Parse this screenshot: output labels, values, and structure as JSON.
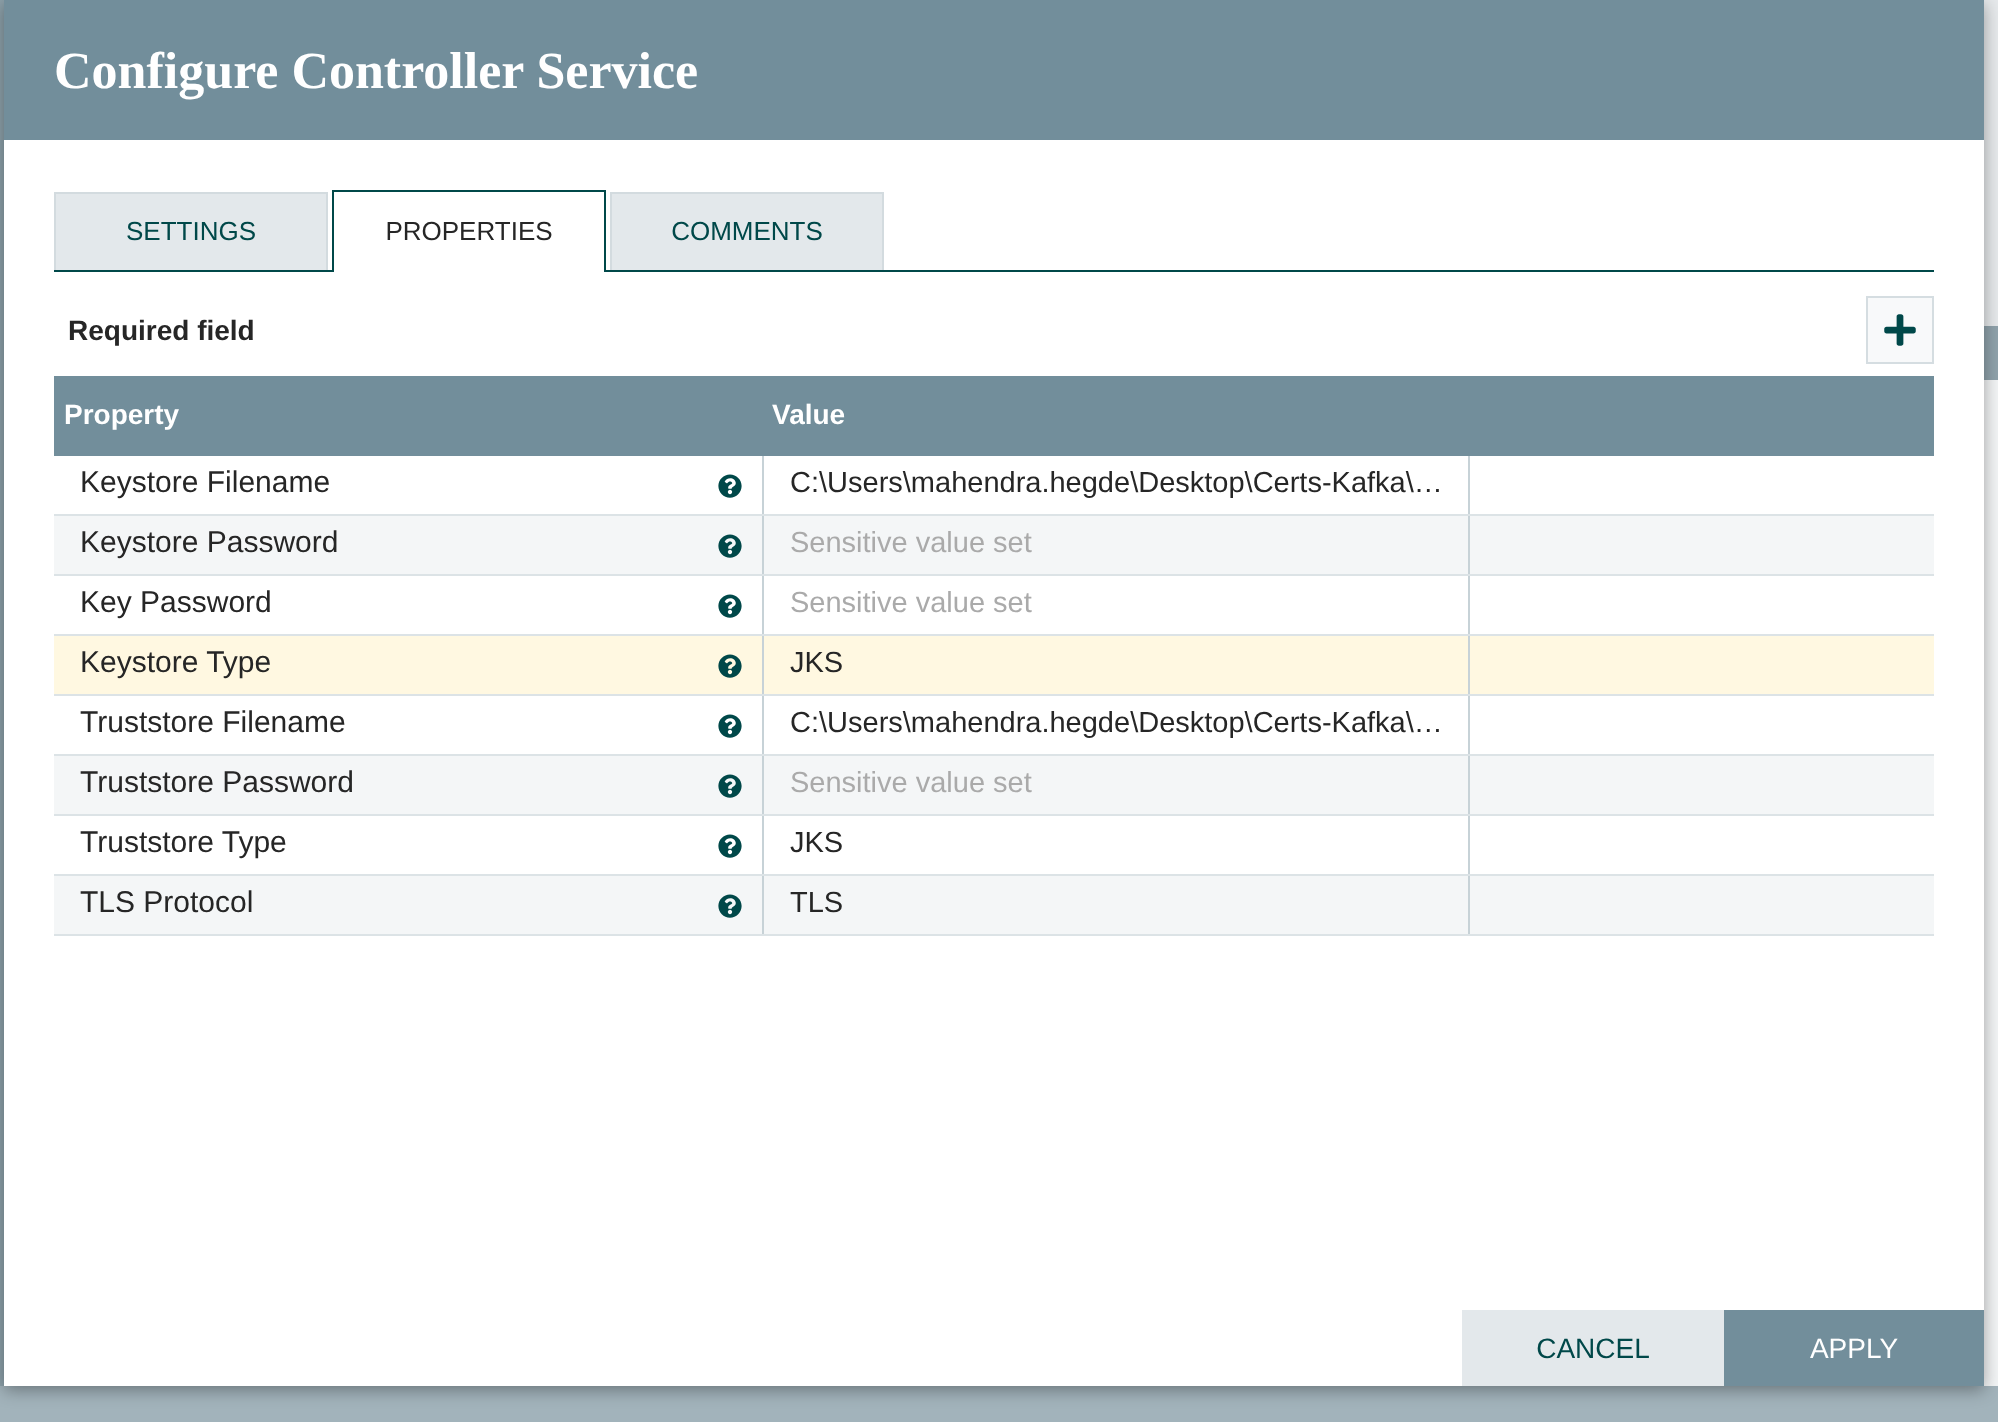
{
  "dialog": {
    "title": "Configure Controller Service"
  },
  "tabs": [
    {
      "label": "SETTINGS",
      "selected": false
    },
    {
      "label": "PROPERTIES",
      "selected": true
    },
    {
      "label": "COMMENTS",
      "selected": false
    }
  ],
  "properties_panel": {
    "required_label": "Required field",
    "table": {
      "columns": [
        "Property",
        "Value"
      ],
      "rows": [
        {
          "property": "Keystore Filename",
          "value": "C:\\Users\\mahendra.hegde\\Desktop\\Certs-Kafka\\…",
          "kind": "plain",
          "selected": false
        },
        {
          "property": "Keystore Password",
          "value": "Sensitive value set",
          "kind": "sensitive",
          "selected": false
        },
        {
          "property": "Key Password",
          "value": "Sensitive value set",
          "kind": "sensitive",
          "selected": false
        },
        {
          "property": "Keystore Type",
          "value": "JKS",
          "kind": "plain",
          "selected": true
        },
        {
          "property": "Truststore Filename",
          "value": "C:\\Users\\mahendra.hegde\\Desktop\\Certs-Kafka\\…",
          "kind": "plain",
          "selected": false
        },
        {
          "property": "Truststore Password",
          "value": "Sensitive value set",
          "kind": "sensitive",
          "selected": false
        },
        {
          "property": "Truststore Type",
          "value": "JKS",
          "kind": "plain",
          "selected": false
        },
        {
          "property": "TLS Protocol",
          "value": "TLS",
          "kind": "plain",
          "selected": false
        }
      ]
    }
  },
  "buttons": [
    {
      "label": "CANCEL",
      "kind": "secondary"
    },
    {
      "label": "APPLY",
      "kind": "primary"
    }
  ]
}
